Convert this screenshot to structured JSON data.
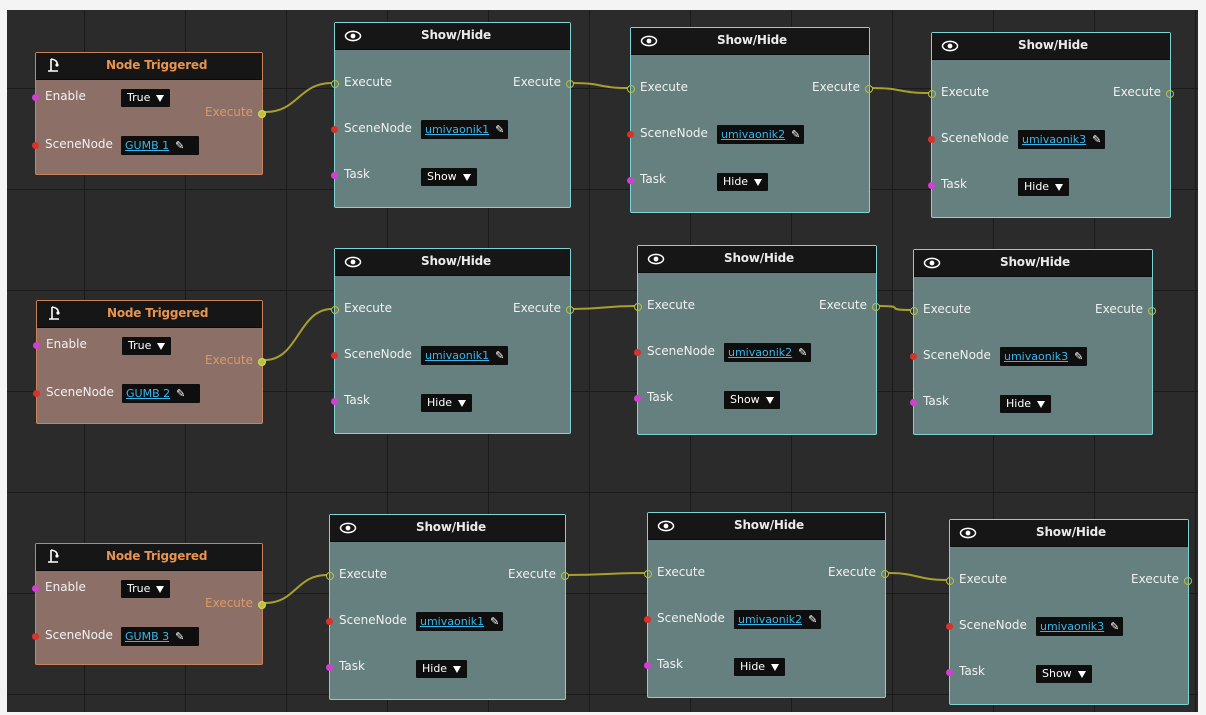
{
  "colors": {
    "canvas": "#2b2b2b",
    "trigger_header_text": "#e8934f",
    "trigger_body": "#8c7068",
    "showhide_body": "#667f7f",
    "showhide_border": "#7fd3d3",
    "link": "#37b7ec",
    "wire": "#a8a02c",
    "pin_enable": "#d33fd3",
    "pin_scenenode": "#d8322a"
  },
  "labels": {
    "enable": "Enable",
    "scene_node": "SceneNode",
    "execute": "Execute",
    "task": "Task"
  },
  "rows": [
    {
      "trigger": {
        "title": "Node Triggered",
        "enable_value": "True",
        "scene_node": "GUMB 1",
        "icon": "trigger-lever-icon"
      },
      "show_hide": [
        {
          "title": "Show/Hide",
          "icon": "eye-icon",
          "scene_node": "umivaonik1",
          "task": "Show"
        },
        {
          "title": "Show/Hide",
          "icon": "eye-icon",
          "scene_node": "umivaonik2",
          "task": "Hide"
        },
        {
          "title": "Show/Hide",
          "icon": "eye-icon",
          "scene_node": "umivaonik3",
          "task": "Hide"
        }
      ]
    },
    {
      "trigger": {
        "title": "Node Triggered",
        "enable_value": "True",
        "scene_node": "GUMB 2",
        "icon": "trigger-lever-icon"
      },
      "show_hide": [
        {
          "title": "Show/Hide",
          "icon": "eye-icon",
          "scene_node": "umivaonik1",
          "task": "Hide"
        },
        {
          "title": "Show/Hide",
          "icon": "eye-icon",
          "scene_node": "umivaonik2",
          "task": "Show"
        },
        {
          "title": "Show/Hide",
          "icon": "eye-icon",
          "scene_node": "umivaonik3",
          "task": "Hide"
        }
      ]
    },
    {
      "trigger": {
        "title": "Node Triggered",
        "enable_value": "True",
        "scene_node": "GUMB 3",
        "icon": "trigger-lever-icon"
      },
      "show_hide": [
        {
          "title": "Show/Hide",
          "icon": "eye-icon",
          "scene_node": "umivaonik1",
          "task": "Hide"
        },
        {
          "title": "Show/Hide",
          "icon": "eye-icon",
          "scene_node": "umivaonik2",
          "task": "Hide"
        },
        {
          "title": "Show/Hide",
          "icon": "eye-icon",
          "scene_node": "umivaonik3",
          "task": "Show"
        }
      ]
    }
  ]
}
